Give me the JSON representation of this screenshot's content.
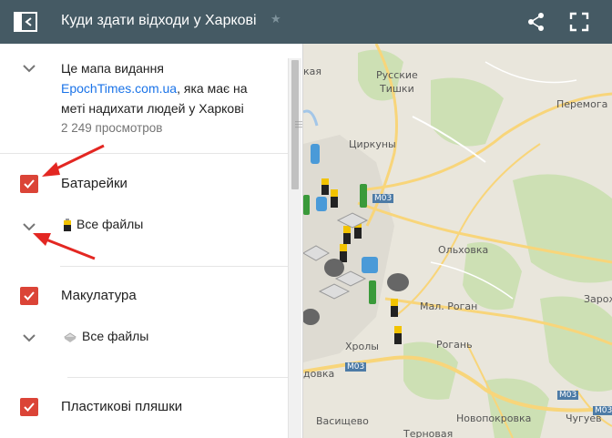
{
  "header": {
    "title": "Куди здати відходи у Харкові",
    "icons": {
      "back": "sidebar-toggle-icon",
      "star": "star-icon",
      "share": "share-icon",
      "fullscreen": "fullscreen-icon"
    }
  },
  "description": {
    "line1": "Це мапа видання",
    "link": "EpochTimes.com.ua",
    "line2": ", яка має на",
    "line3": "меті надихати людей у Харкові",
    "views": "2 249 просмотров"
  },
  "layers": [
    {
      "label": "Батарейки",
      "checked": true,
      "sublabel": "Все файлы",
      "icon": "battery-icon"
    },
    {
      "label": "Макулатура",
      "checked": true,
      "sublabel": "Все файлы",
      "icon": "paper-icon"
    },
    {
      "label": "Пластикові пляшки",
      "checked": true
    }
  ],
  "map": {
    "places": [
      "Русские",
      "Тишки",
      "Перемога",
      "Циркуны",
      "Ольховка",
      "Мал. Роган",
      "Рогань",
      "Хролы",
      "Зарож",
      "Новопокровка",
      "Васищево",
      "Терновая",
      "Чугуев",
      "довка",
      "кая"
    ],
    "roads": [
      "М03",
      "М03",
      "М03",
      "М03"
    ]
  },
  "colors": {
    "header": "#455a64",
    "checkbox": "#db4437",
    "link": "#1a73e8"
  }
}
